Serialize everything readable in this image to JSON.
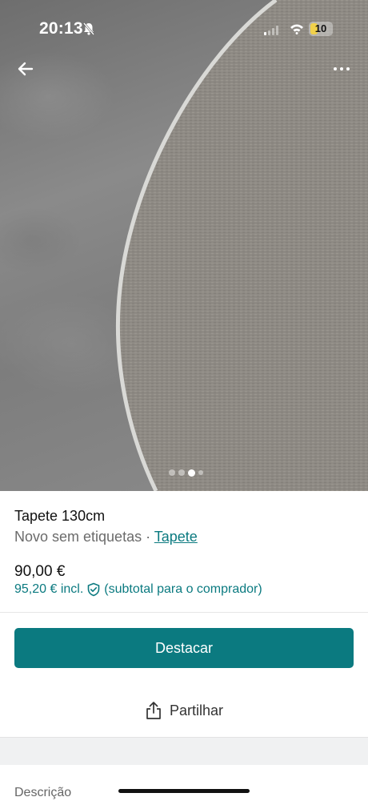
{
  "status_bar": {
    "time": "20:13",
    "battery": "10",
    "battery_level": 0.33
  },
  "gallery": {
    "image_count": 4,
    "active_index": 2
  },
  "item": {
    "title": "Tapete 130cm",
    "condition": "Novo sem etiquetas",
    "separator": " · ",
    "category": "Tapete",
    "price": "90,00 €",
    "price_incl": "95,20 € incl.",
    "price_incl_note": "(subtotal para o comprador)"
  },
  "actions": {
    "primary": "Destacar",
    "share": "Partilhar"
  },
  "section": {
    "description_label": "Descrição"
  },
  "colors": {
    "accent": "#0b7a80"
  },
  "icons": [
    "arrow-left-icon",
    "more-icon",
    "shield-check-icon",
    "share-icon",
    "bell-slash-icon",
    "wifi-icon",
    "signal-icon"
  ]
}
